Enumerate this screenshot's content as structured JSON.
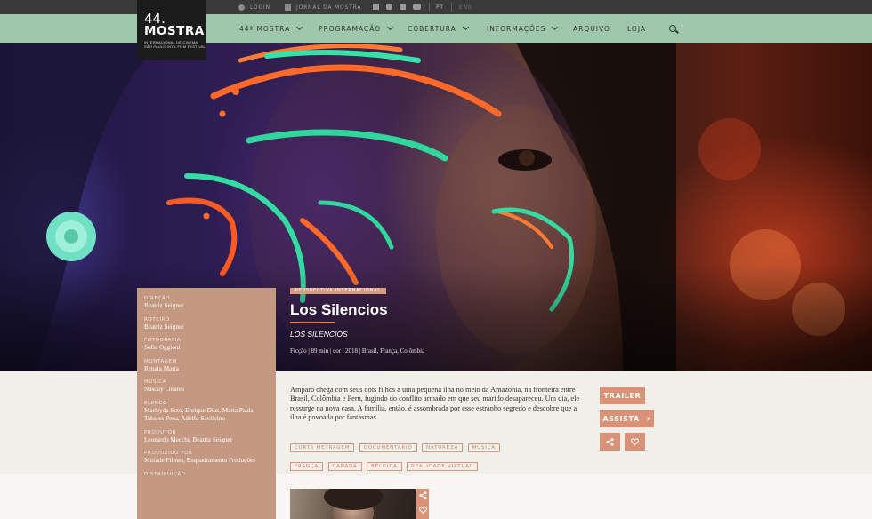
{
  "topbar": {
    "login_label": "LOGIN",
    "journal_label": "JORNAL DA MOSTRA",
    "social_icons": [
      "facebook-icon",
      "instagram-icon",
      "twitter-icon",
      "youtube-icon"
    ],
    "lang_pt": "PT",
    "lang_eng": "ENG"
  },
  "logo": {
    "number": "44.",
    "name": "MOSTRA",
    "subtitle_line1": "INTERNACIONAL DE CINEMA",
    "subtitle_line2": "SÃO PAULO INT'L FILM FESTIVAL"
  },
  "nav": {
    "items": [
      {
        "label": "44ª MOSTRA",
        "has_dropdown": true
      },
      {
        "label": "PROGRAMAÇÃO",
        "has_dropdown": true
      },
      {
        "label": "COBERTURA",
        "has_dropdown": true
      },
      {
        "label": "INFORMAÇÕES",
        "has_dropdown": true
      },
      {
        "label": "ARQUIVO",
        "has_dropdown": false
      },
      {
        "label": "LOJA",
        "has_dropdown": false
      }
    ],
    "search_icon": "search-icon"
  },
  "film": {
    "category": "PERSPECTIVA INTERNACIONAL",
    "title": "Los Silencios",
    "original_title": "LOS SILENCIOS",
    "meta": "Ficção | 89 min | cor | 2018 | Brasil, França, Colômbia",
    "synopsis": "Amparo chega com seus dois filhos a uma pequena ilha no meio da Amazônia, na fronteira entre Brasil, Colômbia e Peru, fugindo do conflito armado em que seu marido desapareceu. Um dia, ele ressurge na nova casa. A família, então, é assombrada por esse estranho segredo e descobre que a ilha é povoada por fantasmas.",
    "tags": [
      "CURTA METRAGEM",
      "DOCUMENTÁRIO",
      "NATUREZA",
      "MÚSICA",
      "FRANÇA",
      "CANADÁ",
      "BÉLGICA",
      "REALIDADE VIRTUAL"
    ]
  },
  "credits": [
    {
      "role": "DIREÇÃO",
      "name": "Beatriz Seigner"
    },
    {
      "role": "ROTEIRO",
      "name": "Beatriz Seigner"
    },
    {
      "role": "FOTOGRAFIA",
      "name": "Sofia Oggioni"
    },
    {
      "role": "MONTAGEM",
      "name": "Renata Maria"
    },
    {
      "role": "MÚSICA",
      "name": "Nascuy Linares"
    },
    {
      "role": "ELENCO",
      "name": "Marleyda Soto, Enrique Diaz, Maria Paula Tabares Pena, Adolfo Savilvino"
    },
    {
      "role": "PRODUTOR",
      "name": "Leonardo Mecchi, Beatriz Seigner"
    },
    {
      "role": "PRODUZIDO POR",
      "name": "Miríade Filmes, Enquadramento Produções"
    },
    {
      "role": "DISTRIBUIÇÃO",
      "name": ""
    }
  ],
  "actions": {
    "trailer_label": "TRAILER",
    "watch_label": "ASSISTA",
    "watch_icon": "chevron-right-icon",
    "share_icon": "share-icon",
    "favorite_icon": "heart-icon"
  },
  "colors": {
    "nav_green": "#9ec7ab",
    "accent_salmon": "#d99277",
    "credits_bg": "#c59882",
    "topbar_dark": "#3a3a3a"
  }
}
